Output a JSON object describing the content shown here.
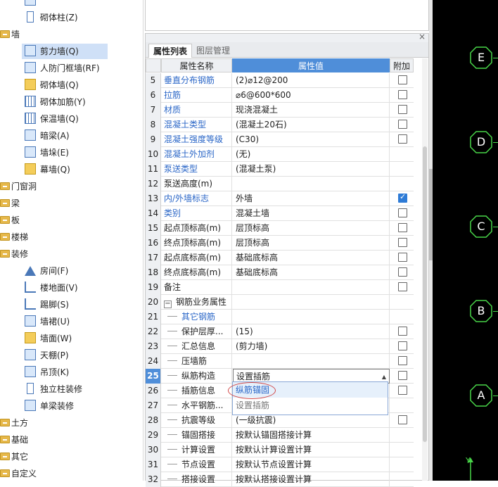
{
  "tree": {
    "items": [
      {
        "type": "leaf",
        "label": "",
        "icon": "wall-cross-icon",
        "partial": true
      },
      {
        "type": "leaf",
        "label": "砌体柱(Z)",
        "icon": "column-icon"
      },
      {
        "type": "cat",
        "label": "墙"
      },
      {
        "type": "leaf",
        "label": "剪力墙(Q)",
        "icon": "shear-wall-icon",
        "selected": true
      },
      {
        "type": "leaf",
        "label": "人防门框墙(RF)",
        "icon": "door-frame-wall-icon"
      },
      {
        "type": "leaf",
        "label": "砌体墙(Q)",
        "icon": "masonry-wall-icon"
      },
      {
        "type": "leaf",
        "label": "砌体加筋(Y)",
        "icon": "masonry-rebar-icon"
      },
      {
        "type": "leaf",
        "label": "保温墙(Q)",
        "icon": "insulation-wall-icon"
      },
      {
        "type": "leaf",
        "label": "暗梁(A)",
        "icon": "hidden-beam-icon"
      },
      {
        "type": "leaf",
        "label": "墙垛(E)",
        "icon": "wall-pier-icon"
      },
      {
        "type": "leaf",
        "label": "幕墙(Q)",
        "icon": "curtain-wall-icon"
      },
      {
        "type": "cat",
        "label": "门窗洞"
      },
      {
        "type": "cat",
        "label": "梁"
      },
      {
        "type": "cat",
        "label": "板"
      },
      {
        "type": "cat",
        "label": "楼梯"
      },
      {
        "type": "cat",
        "label": "装修"
      },
      {
        "type": "leaf",
        "label": "房间(F)",
        "icon": "room-icon"
      },
      {
        "type": "leaf",
        "label": "楼地面(V)",
        "icon": "floor-icon"
      },
      {
        "type": "leaf",
        "label": "踢脚(S)",
        "icon": "skirting-icon"
      },
      {
        "type": "leaf",
        "label": "墙裙(U)",
        "icon": "dado-icon"
      },
      {
        "type": "leaf",
        "label": "墙面(W)",
        "icon": "wall-surface-icon"
      },
      {
        "type": "leaf",
        "label": "天棚(P)",
        "icon": "ceiling-icon"
      },
      {
        "type": "leaf",
        "label": "吊顶(K)",
        "icon": "suspended-ceiling-icon"
      },
      {
        "type": "leaf",
        "label": "独立柱装修",
        "icon": "column-finish-icon"
      },
      {
        "type": "leaf",
        "label": "单梁装修",
        "icon": "beam-finish-icon"
      },
      {
        "type": "cat",
        "label": "土方"
      },
      {
        "type": "cat",
        "label": "基础"
      },
      {
        "type": "cat",
        "label": "其它"
      },
      {
        "type": "cat",
        "label": "自定义"
      }
    ]
  },
  "panel": {
    "tabs": [
      "属性列表",
      "图层管理"
    ],
    "headers": {
      "name": "属性名称",
      "value": "属性值",
      "add": "附加"
    },
    "rows": [
      {
        "n": "5",
        "k": "垂直分布钢筋",
        "v": "(2)⌀12@200",
        "blue": true,
        "cb": true,
        "on": false
      },
      {
        "n": "6",
        "k": "拉筋",
        "v": "⌀6@600*600",
        "blue": true,
        "cb": true,
        "on": false
      },
      {
        "n": "7",
        "k": "材质",
        "v": "现浇混凝土",
        "blue": true,
        "cb": true,
        "on": false
      },
      {
        "n": "8",
        "k": "混凝土类型",
        "v": "(混凝土20石)",
        "blue": true,
        "cb": true,
        "on": false
      },
      {
        "n": "9",
        "k": "混凝土强度等级",
        "v": "(C30)",
        "blue": true,
        "cb": true,
        "on": false
      },
      {
        "n": "10",
        "k": "混凝土外加剂",
        "v": "(无)",
        "blue": true,
        "cb": false
      },
      {
        "n": "11",
        "k": "泵送类型",
        "v": "(混凝土泵)",
        "blue": true,
        "cb": false
      },
      {
        "n": "12",
        "k": "泵送高度(m)",
        "v": "",
        "blue": false,
        "cb": false
      },
      {
        "n": "13",
        "k": "内/外墙标志",
        "v": "外墙",
        "blue": true,
        "cb": true,
        "on": true
      },
      {
        "n": "14",
        "k": "类别",
        "v": "混凝土墙",
        "blue": true,
        "cb": true,
        "on": false
      },
      {
        "n": "15",
        "k": "起点顶标高(m)",
        "v": "层顶标高",
        "blue": false,
        "cb": true,
        "on": false
      },
      {
        "n": "16",
        "k": "终点顶标高(m)",
        "v": "层顶标高",
        "blue": false,
        "cb": true,
        "on": false
      },
      {
        "n": "17",
        "k": "起点底标高(m)",
        "v": "基础底标高",
        "blue": false,
        "cb": true,
        "on": false
      },
      {
        "n": "18",
        "k": "终点底标高(m)",
        "v": "基础底标高",
        "blue": false,
        "cb": true,
        "on": false
      },
      {
        "n": "19",
        "k": "备注",
        "v": "",
        "blue": false,
        "cb": true,
        "on": false
      },
      {
        "n": "20",
        "k": "钢筋业务属性",
        "v": "",
        "blue": false,
        "cb": false,
        "group": true
      },
      {
        "n": "21",
        "k": "其它钢筋",
        "v": "",
        "blue": true,
        "cb": false,
        "sub": true
      },
      {
        "n": "22",
        "k": "保护层厚...",
        "v": "(15)",
        "blue": false,
        "cb": true,
        "on": false,
        "sub": true
      },
      {
        "n": "23",
        "k": "汇总信息",
        "v": "(剪力墙)",
        "blue": false,
        "cb": true,
        "on": false,
        "sub": true
      },
      {
        "n": "24",
        "k": "压墙筋",
        "v": "",
        "blue": false,
        "cb": true,
        "on": false,
        "sub": true
      },
      {
        "n": "25",
        "k": "纵筋构造",
        "v": "设置插筋",
        "blue": false,
        "cb": true,
        "on": false,
        "sub": true,
        "selected": true
      },
      {
        "n": "26",
        "k": "插筋信息",
        "v": "",
        "blue": false,
        "cb": true,
        "on": false,
        "sub": true
      },
      {
        "n": "27",
        "k": "水平钢筋...",
        "v": "",
        "blue": false,
        "cb": false,
        "sub": true
      },
      {
        "n": "28",
        "k": "抗震等级",
        "v": "(一级抗震)",
        "blue": false,
        "cb": true,
        "on": false,
        "sub": true
      },
      {
        "n": "29",
        "k": "锚固搭接",
        "v": "按默认锚固搭接计算",
        "blue": false,
        "cb": false,
        "sub": true
      },
      {
        "n": "30",
        "k": "计算设置",
        "v": "按默认计算设置计算",
        "blue": false,
        "cb": false,
        "sub": true
      },
      {
        "n": "31",
        "k": "节点设置",
        "v": "按默认节点设置计算",
        "blue": false,
        "cb": false,
        "sub": true
      },
      {
        "n": "32",
        "k": "搭接设置",
        "v": "按默认搭接设置计算",
        "blue": false,
        "cb": false,
        "sub": true
      }
    ],
    "dropdown": {
      "options": [
        "纵筋锚固",
        "设置插筋"
      ]
    }
  },
  "canvas": {
    "axes": [
      "E",
      "D",
      "C",
      "B",
      "A"
    ],
    "y_label": "Y",
    "colors": {
      "axis": "#49d649",
      "background": "#000000"
    }
  }
}
